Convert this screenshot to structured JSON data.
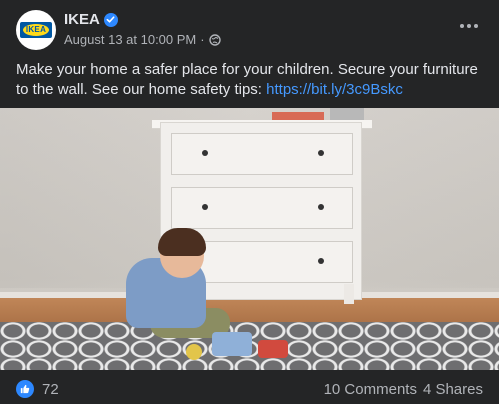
{
  "page": {
    "name": "IKEA",
    "timestamp": "August 13 at 10:00 PM",
    "avatar_text": "IKEA"
  },
  "post": {
    "text": "Make your home a safer place for your children. Secure your furniture to the wall. See our home safety tips: ",
    "link": "https://bit.ly/3c9Bskc"
  },
  "footer": {
    "likes": "72",
    "comments": "10 Comments",
    "shares": "4 Shares"
  },
  "icons": {
    "verified": "verified-badge-icon",
    "audience": "globe-icon",
    "more": "more-options-icon",
    "like": "like-reaction-icon"
  },
  "colors": {
    "background": "#242526",
    "accent": "#2d88ff",
    "link": "#4599ff",
    "text": "#e4e6eb",
    "muted": "#b0b3b8"
  }
}
